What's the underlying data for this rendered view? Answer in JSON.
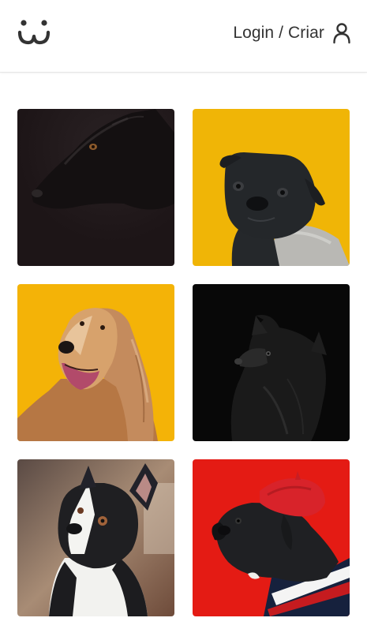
{
  "header": {
    "logo_icon": "dog-face-logo-icon",
    "auth_label": "Login / Criar",
    "user_icon": "user-icon"
  },
  "photos": [
    {
      "id": "photo-1",
      "subject": "black-dog",
      "background": "#211819"
    },
    {
      "id": "photo-2",
      "subject": "pug-sweater",
      "background": "#f0b506"
    },
    {
      "id": "photo-3",
      "subject": "afghan-hound",
      "background": "#f4b307"
    },
    {
      "id": "photo-4",
      "subject": "black-fluffy-dog",
      "background": "#080808"
    },
    {
      "id": "photo-5",
      "subject": "boston-terrier",
      "background": "#8a6f5c"
    },
    {
      "id": "photo-6",
      "subject": "pug-beret",
      "background": "#e41b14"
    }
  ]
}
